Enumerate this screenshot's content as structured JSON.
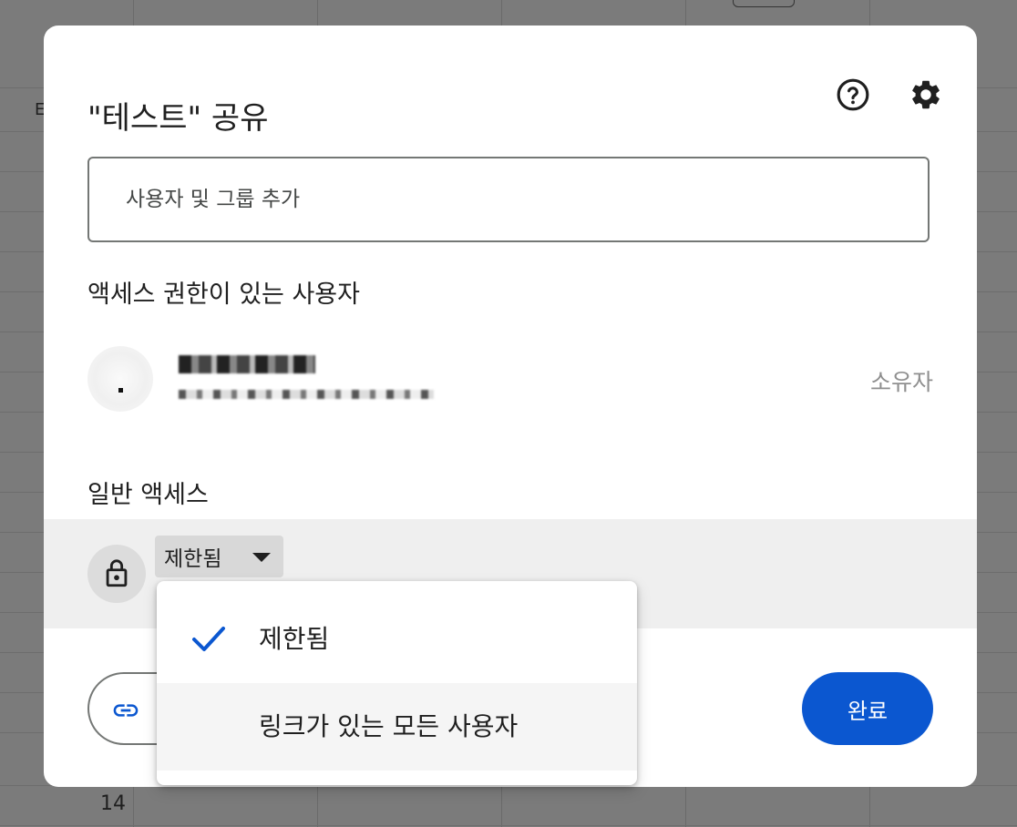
{
  "background": {
    "column_letter": "E",
    "row_number": "14"
  },
  "dialog": {
    "title": "\"테스트\" 공유",
    "help_icon": "help-circle-icon",
    "settings_icon": "gear-icon"
  },
  "add_people": {
    "placeholder": "사용자 및 그룹 추가"
  },
  "people_with_access": {
    "title": "액세스 권한이 있는 사용자",
    "people": [
      {
        "role": "소유자"
      }
    ]
  },
  "general_access": {
    "title": "일반 액세스",
    "icon": "lock-icon",
    "selected": "제한됨",
    "options": [
      {
        "label": "제한됨",
        "checked": true
      },
      {
        "label": "링크가 있는 모든 사용자",
        "checked": false
      }
    ]
  },
  "footer": {
    "copy_link_icon": "link-icon",
    "done_label": "완료"
  },
  "colors": {
    "primary": "#0b57d0",
    "check": "#0b57d0",
    "highlight_row": "#efefef"
  }
}
